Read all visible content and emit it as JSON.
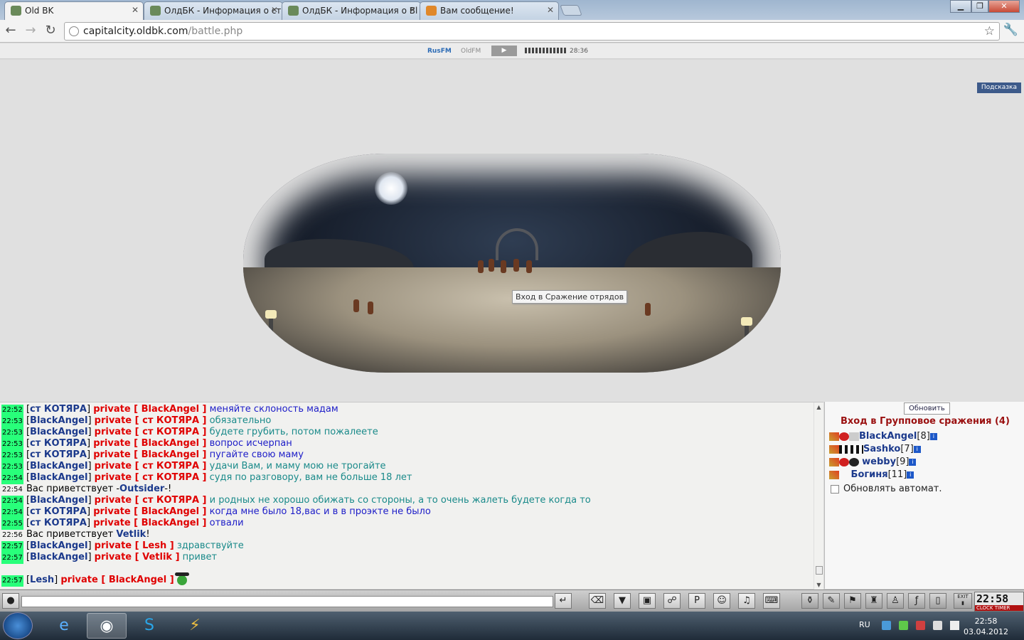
{
  "browser": {
    "tabs": [
      {
        "title": "Old BK",
        "active": true
      },
      {
        "title": "ОлдБК - Информация о ст",
        "active": false
      },
      {
        "title": "ОлдБК - Информация о Bl",
        "active": false
      },
      {
        "title": "Вам сообщение!",
        "active": false
      }
    ],
    "url_host": "capitalcity.oldbk.com",
    "url_path": "/battle.php"
  },
  "radio": {
    "rus": "RusFM",
    "old": "OldFM",
    "time": "28:36"
  },
  "game": {
    "hint_label": "Подсказка",
    "tooltip": "Вход в Сражение отрядов"
  },
  "chat": {
    "lines": [
      {
        "time": "22:52",
        "from": "ст КОТЯРА",
        "to": "BlackAngel",
        "text": "меняйте склоность мадам",
        "tone": "blue"
      },
      {
        "time": "22:53",
        "from": "BlackAngel",
        "to": "ст КОТЯРА",
        "text": "обязательно",
        "tone": "teal"
      },
      {
        "time": "22:53",
        "from": "BlackAngel",
        "to": "ст КОТЯРА",
        "text": "будете грубить, потом пожалеете",
        "tone": "teal"
      },
      {
        "time": "22:53",
        "from": "ст КОТЯРА",
        "to": "BlackAngel",
        "text": "вопрос исчерпан",
        "tone": "blue"
      },
      {
        "time": "22:53",
        "from": "ст КОТЯРА",
        "to": "BlackAngel",
        "text": "пугайте свою маму",
        "tone": "blue"
      },
      {
        "time": "22:53",
        "from": "BlackAngel",
        "to": "ст КОТЯРА",
        "text": "удачи Вам, и маму мою не трогайте",
        "tone": "teal"
      },
      {
        "time": "22:54",
        "from": "BlackAngel",
        "to": "ст КОТЯРА",
        "text": "судя по разговору, вам не больше 18 лет",
        "tone": "teal"
      },
      {
        "time": "22:54",
        "system": true,
        "prefix": "Вас приветствует -",
        "name": "Outsider",
        "suffix": "-!"
      },
      {
        "time": "22:54",
        "from": "BlackAngel",
        "to": "ст КОТЯРА",
        "text": "и родных не хорошо обижать со стороны, а то очень жалеть будете когда то",
        "tone": "teal"
      },
      {
        "time": "22:54",
        "from": "ст КОТЯРА",
        "to": "BlackAngel",
        "text": "когда мне было 18,вас и в в проэкте не было",
        "tone": "blue"
      },
      {
        "time": "22:55",
        "from": "ст КОТЯРА",
        "to": "BlackAngel",
        "text": "отвали",
        "tone": "blue"
      },
      {
        "time": "22:56",
        "system": true,
        "prefix": "Вас приветствует ",
        "name": "Vetlik",
        "suffix": "!"
      },
      {
        "time": "22:57",
        "from": "BlackAngel",
        "to": "Lesh",
        "text": "здравствуйте",
        "tone": "teal"
      },
      {
        "time": "22:57",
        "from": "BlackAngel",
        "to": "Vetlik",
        "text": "привет",
        "tone": "teal"
      }
    ],
    "last": {
      "time": "22:57",
      "from": "Lesh",
      "to": "BlackAngel"
    },
    "private_word": "private"
  },
  "battle": {
    "refresh_label": "Обновить",
    "title": "Вход в Групповое сражения (4)",
    "players": [
      {
        "name": "BlackAngel",
        "level": "[8]"
      },
      {
        "name": "Sashko",
        "level": "[7]"
      },
      {
        "name": "webby",
        "level": "[9]"
      },
      {
        "name": "Богиня",
        "level": "[11]"
      }
    ],
    "auto_refresh_label": "Обновлять автомат."
  },
  "bottombar": {
    "clock_time": "22:58",
    "clock_labels": "CLOCK TIMER",
    "exit_label": "EXIT"
  },
  "taskbar": {
    "lang": "RU",
    "time": "22:58",
    "date": "03.04.2012"
  },
  "colors": {
    "timestamp_bg": "#28ff7a",
    "private_red": "#e00000",
    "nick_blue": "#1c3a8c"
  }
}
